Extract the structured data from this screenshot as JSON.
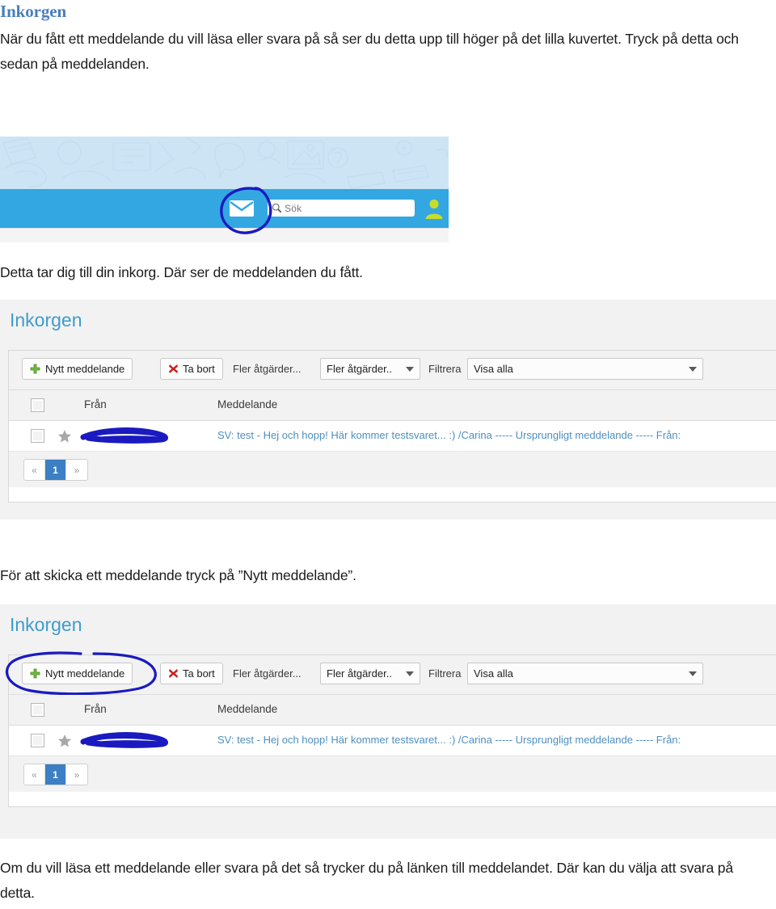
{
  "document": {
    "title": "Inkorgen",
    "paragraphs": {
      "intro": "När du fått ett meddelande du vill läsa eller svara på så ser du detta upp till höger på det lilla kuvertet. Tryck på detta och sedan på meddelanden.",
      "inkorg": "Detta tar dig till din inkorg. Där ser de meddelanden du fått.",
      "skicka": "För att skicka ett meddelande tryck på ”Nytt meddelande”.",
      "lasa": "Om du vill läsa ett meddelande eller svara på det så trycker du på länken till meddelandet. Där kan du välja att svara på detta."
    }
  },
  "screenshot_banner": {
    "envelope_icon": "envelope-icon",
    "search": {
      "icon": "search-icon",
      "placeholder": "Sök",
      "value": ""
    },
    "avatar_icon": "user-avatar-icon",
    "annotation": "hand-drawn-circle-around-envelope",
    "colors": {
      "banner_top": "#cde4f4",
      "banner_bar": "#32a7e2",
      "avatar": "#c6dd2b",
      "pen": "#1a1ac0"
    }
  },
  "inbox_app": {
    "heading": "Inkorgen",
    "toolbar": {
      "new_message_label": "Nytt meddelande",
      "new_message_icon": "plus-icon",
      "delete_label": "Ta bort",
      "delete_icon": "red-x-icon",
      "more_actions_label": "Fler åtgärder...",
      "more_actions_select": "Fler åtgärder..",
      "filter_label": "Filtrera",
      "filter_select": "Visa alla"
    },
    "table": {
      "headers": {
        "checkbox": "",
        "from": "Från",
        "message": "Meddelande"
      },
      "rows": [
        {
          "checkbox": "",
          "star": "star-icon",
          "from": "",
          "from_redacted": true,
          "message": "SV: test - Hej och hopp! Här kommer testsvaret...   :) /Carina   ----- Ursprungligt meddelande ----- Från:"
        }
      ]
    },
    "pagination": {
      "prev": "«",
      "current": "1",
      "next": "»"
    },
    "colors": {
      "heading": "#3e9ccb",
      "link": "#4e8fc0",
      "page_active": "#3c7fc4",
      "delete_icon": "#c9211e",
      "plus_icon": "#6fbd3d"
    }
  },
  "inbox_app_annotated": {
    "annotation": "hand-drawn-circle-around-new-message-button"
  }
}
